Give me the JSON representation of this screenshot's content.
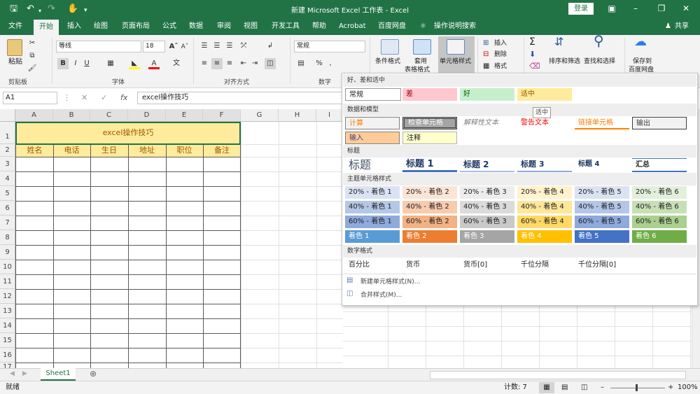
{
  "window": {
    "title": "新建 Microsoft Excel 工作表 - Excel",
    "login": "登录",
    "share": "共享"
  },
  "tabs": [
    "文件",
    "开始",
    "插入",
    "绘图",
    "页面布局",
    "公式",
    "数据",
    "审阅",
    "视图",
    "开发工具",
    "帮助",
    "Acrobat",
    "百度网盘",
    "操作说明搜索"
  ],
  "ribbon": {
    "paste": "粘贴",
    "clipboard": "剪贴板",
    "font_name": "等线",
    "font_size": "18",
    "font_group": "字体",
    "bold": "B",
    "italic": "I",
    "underline": "U",
    "align_group": "对齐方式",
    "number_format": "常规",
    "number_group": "数字",
    "cond_format": "条件格式",
    "table_format_1": "套用",
    "table_format_2": "表格格式",
    "cell_styles": "单元格样式",
    "insert": "插入",
    "delete": "删除",
    "format": "格式",
    "sort": "排序和筛选",
    "find": "查找和选择",
    "save_to_1": "保存到",
    "save_to_2": "百度网盘"
  },
  "formula_bar": {
    "name_box": "A1",
    "fx": "fx",
    "content": "excel操作技巧"
  },
  "sheet": {
    "columns": [
      "A",
      "B",
      "C",
      "D",
      "E",
      "F",
      "G",
      "H",
      "I"
    ],
    "rows": [
      "1",
      "2",
      "3",
      "4",
      "5",
      "6",
      "7",
      "8",
      "9",
      "10",
      "11",
      "12",
      "13",
      "14",
      "15",
      "16",
      "17"
    ],
    "table_title": "excel操作技巧",
    "headers": [
      "姓名",
      "电话",
      "生日",
      "地址",
      "职位",
      "备注"
    ]
  },
  "styles_panel": {
    "sections": [
      "好、差和适中",
      "数据和模型",
      "标题",
      "主题单元格样式",
      "数字格式"
    ],
    "good_bad": [
      "常规",
      "差",
      "好",
      "适中"
    ],
    "data_model": [
      "计算",
      "检查单元格",
      "解释性文本",
      "警告文本",
      "链接单元格",
      "输出",
      "输入",
      "注释"
    ],
    "titles": [
      "标题",
      "标题 1",
      "标题 2",
      "标题 3",
      "标题 4",
      "汇总"
    ],
    "theme_20": [
      "20% - 着色 1",
      "20% - 着色 2",
      "20% - 着色 3",
      "20% - 着色 4",
      "20% - 着色 5",
      "20% - 着色 6"
    ],
    "theme_40": [
      "40% - 着色 1",
      "40% - 着色 2",
      "40% - 着色 3",
      "40% - 着色 4",
      "40% - 着色 5",
      "40% - 着色 6"
    ],
    "theme_60": [
      "60% - 着色 1",
      "60% - 着色 2",
      "60% - 着色 3",
      "60% - 着色 4",
      "60% - 着色 5",
      "60% - 着色 6"
    ],
    "theme_accent": [
      "着色 1",
      "着色 2",
      "着色 3",
      "着色 4",
      "着色 5",
      "着色 6"
    ],
    "number_formats": [
      "百分比",
      "货币",
      "货币[0]",
      "千位分隔",
      "千位分隔[0]"
    ],
    "new_style": "新建单元格样式(N)...",
    "merge_styles": "合并样式(M)...",
    "tooltip": "适中"
  },
  "sheet_tab": "Sheet1",
  "status": {
    "ready": "就绪",
    "count": "计数: 7",
    "zoom": "100%"
  },
  "colors": {
    "excel_green": "#217346",
    "title_fill": "#ffeb9c",
    "title_text": "#9c5700"
  }
}
